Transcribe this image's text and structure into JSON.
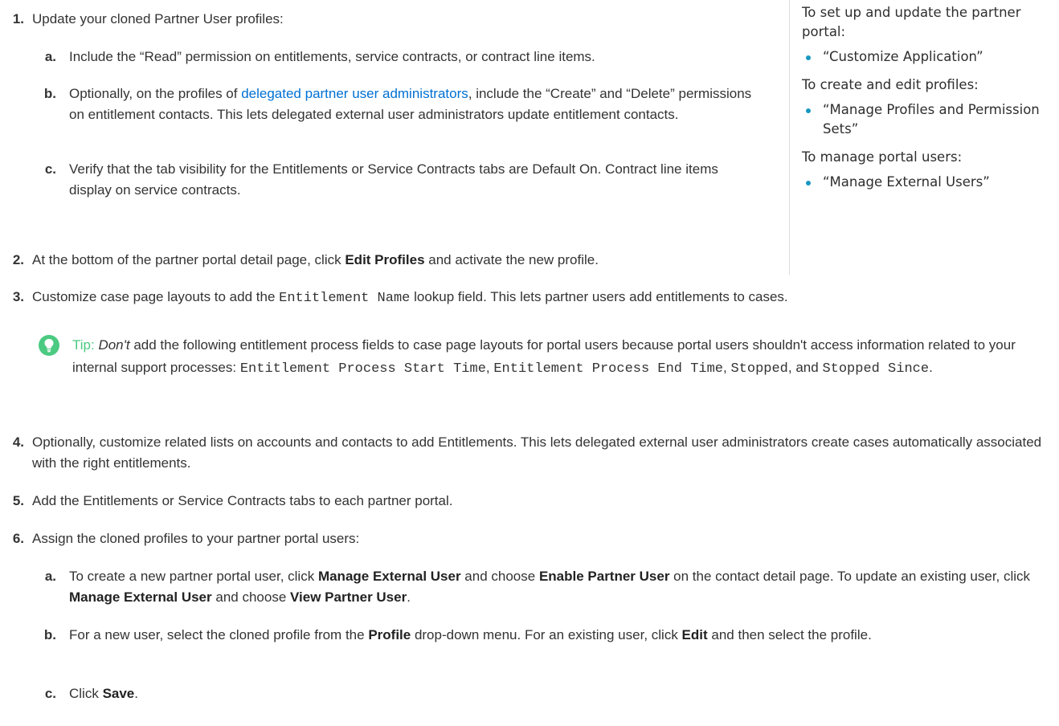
{
  "sidebar": {
    "sections": [
      {
        "heading": "To set up and update the partner portal:",
        "items": [
          "“Customize Application”"
        ]
      },
      {
        "heading": "To create and edit profiles:",
        "items": [
          "“Manage Profiles and Permission Sets”"
        ]
      },
      {
        "heading": "To manage portal users:",
        "items": [
          "“Manage External Users”"
        ]
      }
    ]
  },
  "steps": {
    "s1": {
      "num": "1.",
      "text": "Update your cloned Partner User profiles:",
      "a": {
        "letter": "a.",
        "text": "Include the “Read” permission on entitlements, service contracts, or contract line items."
      },
      "b": {
        "letter": "b.",
        "pre": "Optionally, on the profiles of ",
        "link": "delegated partner user administrators",
        "post": ", include the “Create” and “Delete” permissions on entitlement contacts. This lets delegated external user administrators update entitlement contacts."
      },
      "c": {
        "letter": "c.",
        "text": "Verify that the tab visibility for the Entitlements or Service Contracts tabs are Default On. Contract line items display on service contracts."
      }
    },
    "s2": {
      "num": "2.",
      "pre": "At the bottom of the partner portal detail page, click ",
      "bold": "Edit Profiles",
      "post": " and activate the new profile."
    },
    "s3": {
      "num": "3.",
      "pre": "Customize case page layouts to add the ",
      "code": "Entitlement Name",
      "post": " lookup field. This lets partner users add entitlements to cases."
    },
    "tip": {
      "label": "Tip:",
      "em": "Don't",
      "text": " add the following entitlement process fields to case page layouts for portal users because portal users shouldn't access information related to your internal support processes: ",
      "code1": "Entitlement Process Start Time",
      "sep1": ", ",
      "code2": "Entitlement Process End Time",
      "sep2": ", ",
      "code3": "Stopped",
      "sep3": ", and ",
      "code4": "Stopped Since",
      "end": "."
    },
    "s4": {
      "num": "4.",
      "text": "Optionally, customize related lists on accounts and contacts to add Entitlements. This lets delegated external user administrators create cases automatically associated with the right entitlements."
    },
    "s5": {
      "num": "5.",
      "text": "Add the Entitlements or Service Contracts tabs to each partner portal."
    },
    "s6": {
      "num": "6.",
      "text": "Assign the cloned profiles to your partner portal users:",
      "a": {
        "letter": "a.",
        "t1": "To create a new partner portal user, click ",
        "b1": "Manage External User",
        "t2": " and choose ",
        "b2": "Enable Partner User",
        "t3": " on the contact detail page. To update an existing user, click ",
        "b3": "Manage External User",
        "t4": " and choose ",
        "b4": "View Partner User",
        "t5": "."
      },
      "b": {
        "letter": "b.",
        "t1": "For a new user, select the cloned profile from the ",
        "b1": "Profile",
        "t2": " drop-down menu. For an existing user, click ",
        "b2": "Edit",
        "t3": "  and then select the profile."
      },
      "c": {
        "letter": "c.",
        "t1": "Click ",
        "b1": "Save",
        "t2": "."
      }
    }
  }
}
